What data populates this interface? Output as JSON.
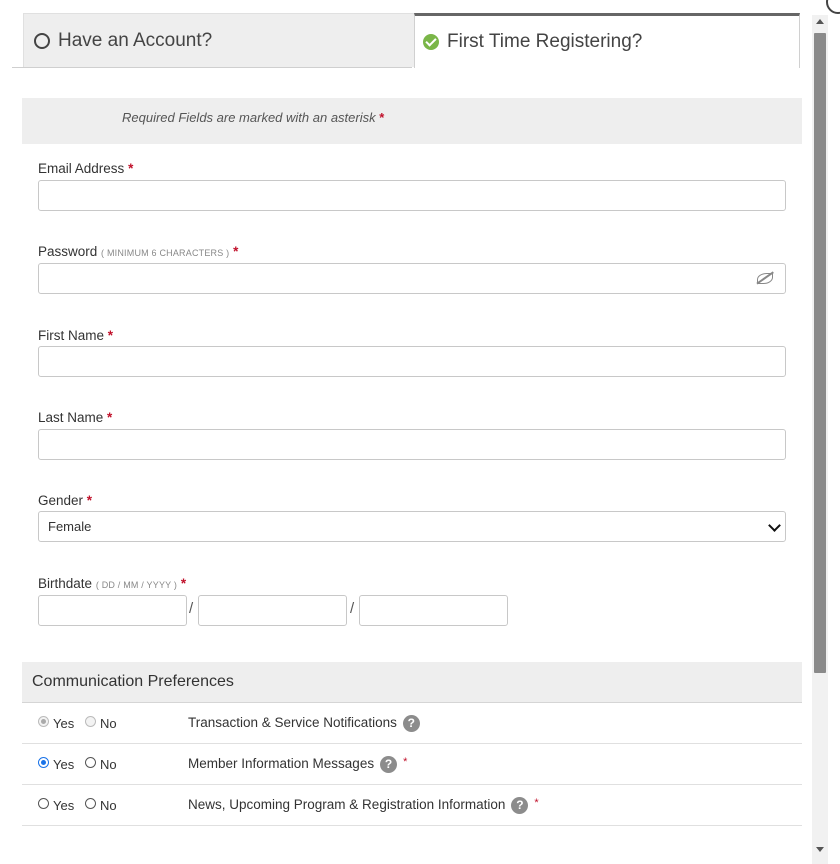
{
  "tabs": {
    "have_account": "Have an Account?",
    "first_time": "First Time Registering?"
  },
  "notice": {
    "text": "Required Fields are marked with an asterisk",
    "asterisk": "*"
  },
  "fields": {
    "email": {
      "label": "Email Address",
      "required": "*",
      "value": ""
    },
    "password": {
      "label": "Password",
      "hint": "( MINIMUM 6 CHARACTERS )",
      "required": "*",
      "value": ""
    },
    "first_name": {
      "label": "First Name",
      "required": "*",
      "value": ""
    },
    "last_name": {
      "label": "Last Name",
      "required": "*",
      "value": ""
    },
    "gender": {
      "label": "Gender",
      "required": "*",
      "selected": "Female"
    },
    "birthdate": {
      "label": "Birthdate",
      "hint": "( DD / MM / YYYY )",
      "required": "*",
      "separator": "/"
    }
  },
  "communication": {
    "title": "Communication Preferences",
    "yes": "Yes",
    "no": "No",
    "help": "?",
    "rows": [
      {
        "label": "Transaction & Service Notifications",
        "selected": "Yes",
        "disabled": true,
        "required": ""
      },
      {
        "label": "Member Information Messages",
        "selected": "Yes",
        "disabled": false,
        "required": "*"
      },
      {
        "label": "News, Upcoming Program & Registration Information",
        "selected": "",
        "disabled": false,
        "required": "*"
      }
    ]
  },
  "colors": {
    "required": "#c0102a",
    "check": "#7ab648",
    "radio_selected": "#1a73e8",
    "panel": "#eeeeee"
  }
}
